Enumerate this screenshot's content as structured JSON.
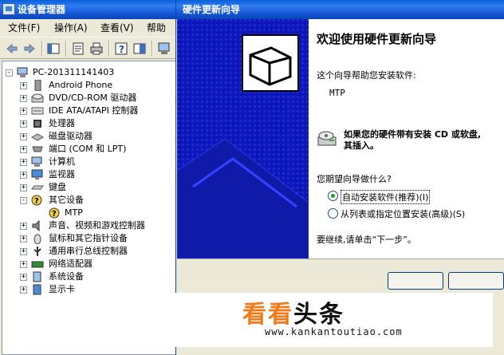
{
  "device_manager": {
    "title": "设备管理器",
    "menu": [
      "文件(F)",
      "操作(A)",
      "查看(V)",
      "帮助"
    ],
    "toolbar_icons": [
      "back-arrow-icon",
      "forward-arrow-icon",
      "show-hide-tree-icon",
      "properties-icon",
      "print-icon",
      "help-icon",
      "view-icon",
      "scan-hardware-icon"
    ],
    "tree": {
      "root": "PC-201311141403",
      "items": [
        {
          "label": "Android Phone",
          "icon": "phone-icon",
          "expander": "+"
        },
        {
          "label": "DVD/CD-ROM 驱动器",
          "icon": "cdrom-icon",
          "expander": "+"
        },
        {
          "label": "IDE ATA/ATAPI 控制器",
          "icon": "ide-controller-icon",
          "expander": "+"
        },
        {
          "label": "处理器",
          "icon": "processor-icon",
          "expander": "+"
        },
        {
          "label": "磁盘驱动器",
          "icon": "disk-drive-icon",
          "expander": "+"
        },
        {
          "label": "端口 (COM 和 LPT)",
          "icon": "port-icon",
          "expander": "+"
        },
        {
          "label": "计算机",
          "icon": "computer-icon",
          "expander": "+"
        },
        {
          "label": "监视器",
          "icon": "monitor-icon",
          "expander": "+"
        },
        {
          "label": "键盘",
          "icon": "keyboard-icon",
          "expander": "+"
        },
        {
          "label": "其它设备",
          "icon": "unknown-device-icon",
          "expander": "-"
        },
        {
          "label": "MTP",
          "icon": "unknown-device-warning-icon",
          "child": true
        },
        {
          "label": "声音、视频和游戏控制器",
          "icon": "sound-icon",
          "expander": "+"
        },
        {
          "label": "鼠标和其它指针设备",
          "icon": "mouse-icon",
          "expander": "+"
        },
        {
          "label": "通用串行总线控制器",
          "icon": "usb-icon",
          "expander": "+"
        },
        {
          "label": "网络适配器",
          "icon": "network-adapter-icon",
          "expander": "+"
        },
        {
          "label": "系统设备",
          "icon": "system-device-icon",
          "expander": "+"
        },
        {
          "label": "显示卡",
          "icon": "display-adapter-icon",
          "expander": "+"
        }
      ]
    }
  },
  "wizard": {
    "title": "硬件更新向导",
    "heading": "欢迎使用硬件更新向导",
    "intro": "这个向导帮助您安装软件:",
    "device": "MTP",
    "cd_note_line1": "如果您的硬件带有安装 CD 或软盘,",
    "cd_note_line2": "其插入。",
    "question": "您期望向导做什么?",
    "options": [
      {
        "label": "自动安装软件(推荐)(I)",
        "selected": true
      },
      {
        "label": "从列表或指定位置安装(高级)(S)",
        "selected": false
      }
    ],
    "continue_text": "要继续,请单击“下一步”。"
  },
  "watermark": {
    "brand_part1": "看看",
    "brand_part2": "头条",
    "url": "www.kankantoutiao.com"
  },
  "colors": {
    "titlebar": "#1556d4",
    "wizard_panel": "#0d16b8",
    "window_bg": "#ece9d8",
    "brand_orange": "#f07a1a"
  }
}
